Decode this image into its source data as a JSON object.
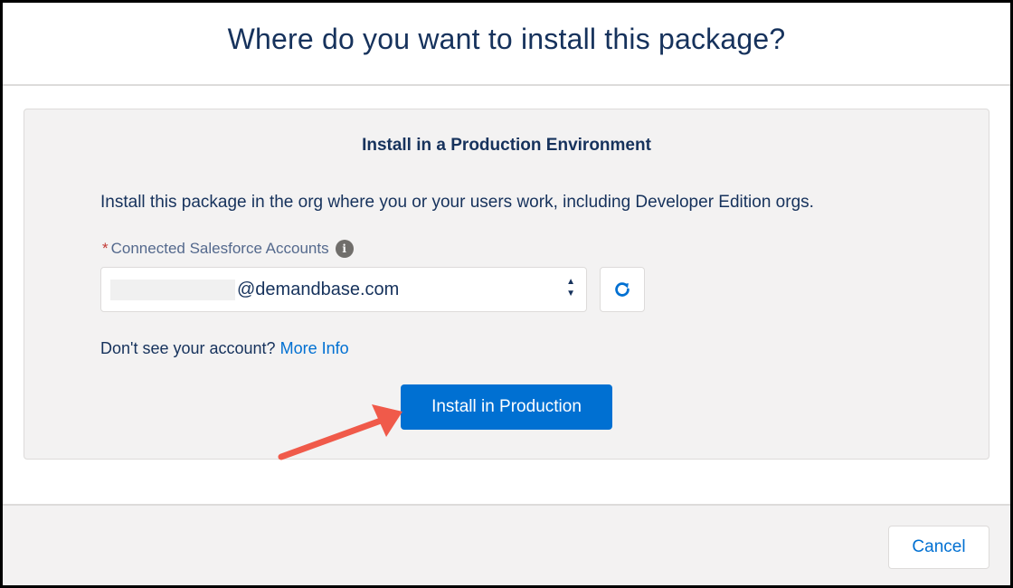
{
  "modal": {
    "title": "Where do you want to install this package?"
  },
  "production": {
    "heading": "Install in a Production Environment",
    "description": "Install this package in the org where you or your users work, including Developer Edition orgs.",
    "field_required_mark": "*",
    "field_label": "Connected Salesforce Accounts",
    "info_icon": "i",
    "selected_account": "@demandbase.com",
    "arrow_up": "▲",
    "arrow_down": "▼",
    "help_text": "Don't see your account?",
    "help_link": "More Info",
    "install_button": "Install in Production"
  },
  "footer": {
    "cancel_button": "Cancel"
  },
  "icons": {
    "info": "info-icon",
    "refresh": "refresh-icon",
    "annotation": "annotation-arrow"
  },
  "colors": {
    "brand_blue": "#0070d2",
    "text_navy": "#16325c",
    "required_red": "#c23934",
    "annotation_arrow": "#f05a4a"
  }
}
